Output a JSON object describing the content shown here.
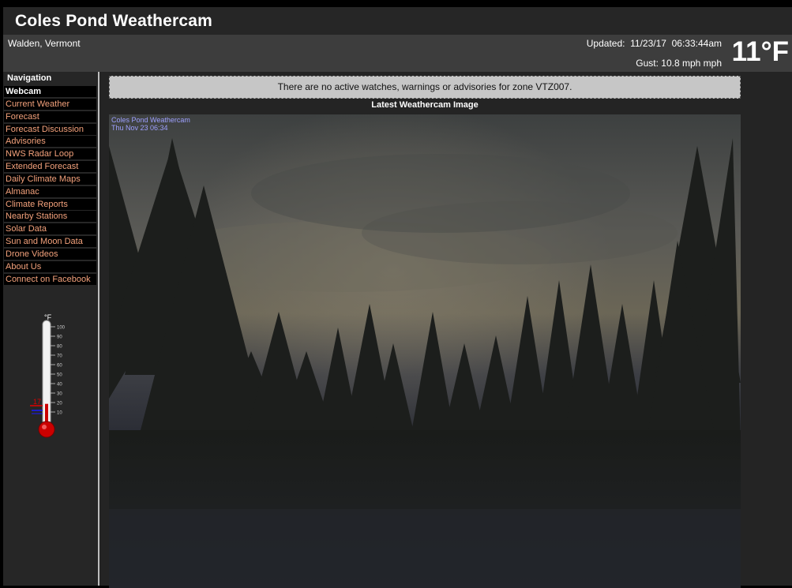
{
  "header": {
    "title": "Coles Pond Weathercam"
  },
  "infobar": {
    "location": "Walden, Vermont",
    "updated": "Updated:  11/23/17  06:33:44am",
    "gust": "Gust: 10.8 mph mph",
    "temperature": "11°F"
  },
  "sidebar": {
    "title": "Navigation",
    "items": [
      {
        "label": "Webcam",
        "active": true
      },
      {
        "label": "Current Weather"
      },
      {
        "label": "Forecast"
      },
      {
        "label": "Forecast Discussion"
      },
      {
        "label": "Advisories"
      },
      {
        "label": "NWS Radar Loop"
      },
      {
        "label": "Extended Forecast"
      },
      {
        "label": "Daily Climate Maps"
      },
      {
        "label": "Almanac"
      },
      {
        "label": "Climate Reports"
      },
      {
        "label": "Nearby Stations"
      },
      {
        "label": "Solar Data"
      },
      {
        "label": "Sun and Moon Data"
      },
      {
        "label": "Drone Videos"
      },
      {
        "label": "About Us"
      },
      {
        "label": "Connect on Facebook"
      }
    ],
    "thermometer": {
      "unit": "°F",
      "marker_value": "17",
      "scale": [
        "100",
        "90",
        "80",
        "70",
        "60",
        "50",
        "40",
        "30",
        "20",
        "10"
      ],
      "level_fraction": 0.11,
      "marker_color": "#e00000",
      "low_color": "#1a1aff"
    }
  },
  "main": {
    "alert": "There are no active watches, warnings or advisories for zone VTZ007.",
    "image_caption": "Latest Weathercam Image",
    "cam_overlay": {
      "line1": "Coles Pond Weathercam",
      "line2": "Thu Nov 23 06:34"
    }
  },
  "colors": {
    "nav_link": "#f4a27c",
    "alert_bg": "#c6c6c6",
    "page_bg": "#242424"
  }
}
